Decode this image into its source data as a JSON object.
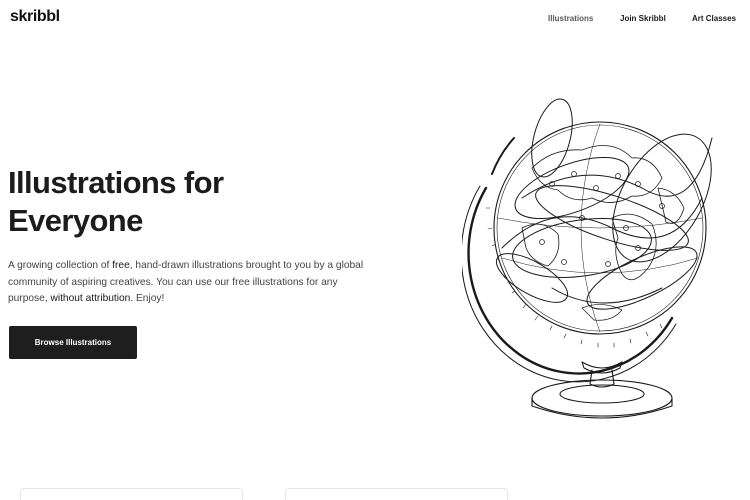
{
  "brand": {
    "name": "skribbl"
  },
  "nav": {
    "items": [
      {
        "label": "Illustrations",
        "active": true
      },
      {
        "label": "Join Skribbl",
        "active": false
      },
      {
        "label": "Art Classes",
        "active": false
      }
    ]
  },
  "hero": {
    "title_line1": "Illustrations for",
    "title_line2": "Everyone",
    "desc_1": "A growing collection of ",
    "desc_free": "free",
    "desc_2": ", hand-drawn illustrations brought to you by a global community of aspiring creatives. You can use our free illustrations for any purpose, ",
    "desc_attr": "without attribution",
    "desc_3": ". Enjoy!",
    "cta_label": "Browse Illustrations"
  },
  "illustration": {
    "icon": "globe-illustration",
    "style": "line-drawing"
  },
  "colors": {
    "text": "#1a1a1a",
    "muted": "#444444",
    "button": "#1e1e1e",
    "background": "#ffffff"
  }
}
